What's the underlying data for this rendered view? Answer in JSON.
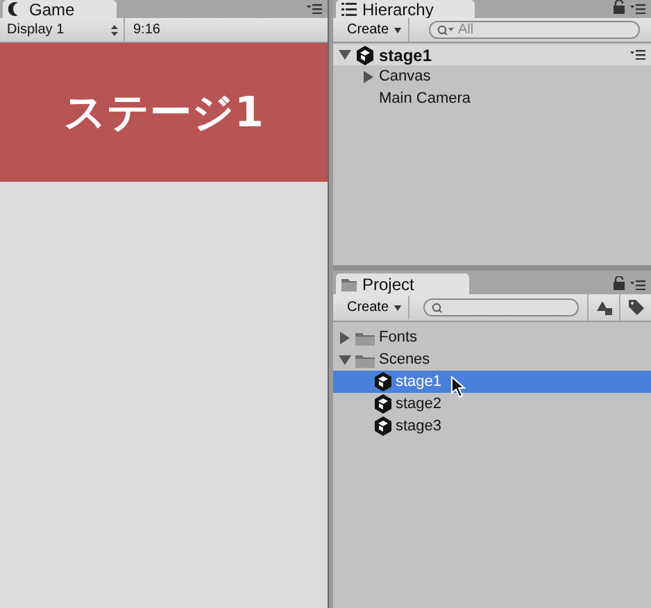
{
  "game": {
    "tab": "Game",
    "display": "Display 1",
    "aspect": "9:16",
    "screen_title": "ステージ1"
  },
  "hierarchy": {
    "tab": "Hierarchy",
    "create": "Create",
    "search_placeholder": "All",
    "scene": {
      "name": "stage1",
      "expanded": true
    },
    "items": [
      {
        "label": "Canvas",
        "kind": "group",
        "expanded": false
      },
      {
        "label": "Main Camera",
        "kind": "object"
      }
    ]
  },
  "project": {
    "tab": "Project",
    "create": "Create",
    "items": [
      {
        "label": "Fonts",
        "kind": "folder",
        "expanded": false,
        "selected": false
      },
      {
        "label": "Scenes",
        "kind": "folder",
        "expanded": true,
        "selected": false,
        "children": [
          {
            "label": "stage1",
            "kind": "scene",
            "selected": true
          },
          {
            "label": "stage2",
            "kind": "scene",
            "selected": false
          },
          {
            "label": "stage3",
            "kind": "scene",
            "selected": false
          }
        ]
      }
    ]
  }
}
